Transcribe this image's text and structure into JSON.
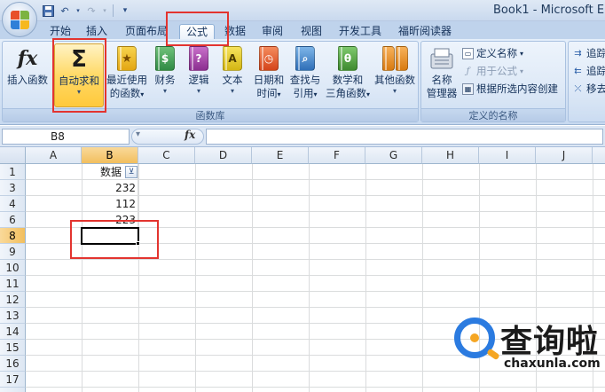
{
  "window": {
    "title": "Book1 - Microsoft E"
  },
  "quick_access": {
    "save_icon": "save-icon",
    "undo_icon": "undo-icon",
    "redo_icon": "redo-icon",
    "customize_icon": "customize-arrow-icon"
  },
  "tabs": [
    "开始",
    "插入",
    "页面布局",
    "公式",
    "数据",
    "审阅",
    "视图",
    "开发工具",
    "福昕阅读器"
  ],
  "active_tab": "公式",
  "ribbon": {
    "function_library": {
      "label": "函数库",
      "insert_function": "插入函数",
      "autosum": "自动求和",
      "recent_line1": "最近使用",
      "recent_line2": "的函数",
      "financial": "财务",
      "logical": "逻辑",
      "text": "文本",
      "datetime_line1": "日期和",
      "datetime_line2": "时间",
      "lookup_line1": "查找与",
      "lookup_line2": "引用",
      "math_line1": "数学和",
      "math_line2": "三角函数",
      "more": "其他函数"
    },
    "defined_names": {
      "label": "定义的名称",
      "name_manager_line1": "名称",
      "name_manager_line2": "管理器",
      "define_name": "定义名称",
      "use_in_formula": "用于公式",
      "create_from_selection": "根据所选内容创建"
    },
    "auditing": {
      "trace_precedents": "追踪",
      "trace_dependents": "追踪",
      "remove_arrows": "移去"
    }
  },
  "formula_bar": {
    "name_box": "B8",
    "fx_label": "fx",
    "content": ""
  },
  "grid": {
    "columns": [
      "A",
      "B",
      "C",
      "D",
      "E",
      "F",
      "G",
      "H",
      "I",
      "J"
    ],
    "rows": [
      "1",
      "3",
      "4",
      "6",
      "8",
      "9",
      "10",
      "11",
      "12",
      "13",
      "14",
      "15",
      "16",
      "17"
    ],
    "selected_row": "8",
    "selected_column": "B",
    "cells": {
      "B1": "数据",
      "B3": "232",
      "B4": "112",
      "B6": "223"
    },
    "filter_icon": "filter-dropdown-icon"
  },
  "watermark": {
    "text": "查询啦",
    "url": "chaxunla.com"
  },
  "colors": {
    "highlight": "#e3342f",
    "selected_header": "#f2bf5e",
    "ribbon": "#d6e4f5"
  }
}
